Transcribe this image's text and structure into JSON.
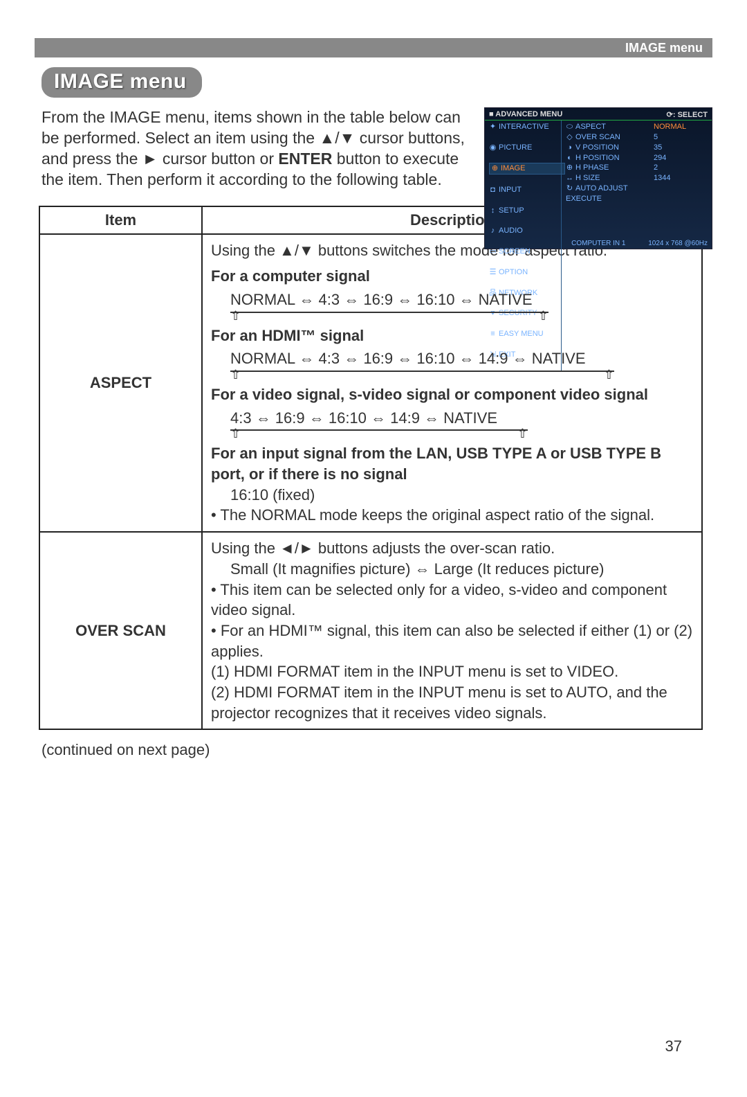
{
  "header": {
    "right": "IMAGE menu"
  },
  "pill": "IMAGE menu",
  "intro": "From the IMAGE menu, items shown in the table below can be performed.\nSelect an item using the ▲/▼ cursor buttons, and press the ► cursor button or ENTER button to execute the item. Then perform it according to the following table.",
  "osd": {
    "top_left": "■ ADVANCED MENU",
    "top_right": "⟳: SELECT",
    "left": [
      {
        "icon": "✦",
        "label": "INTERACTIVE"
      },
      {
        "icon": "◉",
        "label": "PICTURE"
      },
      {
        "icon": "⊕",
        "label": "IMAGE",
        "hl": true
      },
      {
        "icon": "◘",
        "label": "INPUT"
      },
      {
        "icon": "↕",
        "label": "SETUP"
      },
      {
        "icon": "♪",
        "label": "AUDIO"
      },
      {
        "icon": "▭",
        "label": "SCREEN"
      },
      {
        "icon": "☰",
        "label": "OPTION"
      },
      {
        "icon": "品",
        "label": "NETWORK"
      },
      {
        "icon": "♥",
        "label": "SECURITY"
      },
      {
        "icon": "≡",
        "label": "EASY MENU"
      },
      {
        "icon": "⇲",
        "label": "EXIT"
      }
    ],
    "mid": [
      {
        "icon": "⬭",
        "label": "ASPECT"
      },
      {
        "icon": "◇",
        "label": "OVER SCAN"
      },
      {
        "icon": "◑",
        "label": "V POSITION"
      },
      {
        "icon": "◐",
        "label": "H POSITION"
      },
      {
        "icon": "⊕",
        "label": "H PHASE"
      },
      {
        "icon": "↔",
        "label": "H SIZE"
      },
      {
        "icon": "↻",
        "label": "AUTO ADJUST EXECUTE"
      }
    ],
    "right": [
      {
        "label": "NORMAL",
        "hl": true
      },
      {
        "label": "5"
      },
      {
        "label": "35"
      },
      {
        "label": "294"
      },
      {
        "label": "2"
      },
      {
        "label": "1344"
      },
      {
        "label": ""
      }
    ],
    "foot_left": "COMPUTER IN 1",
    "foot_right": "1024 x 768 @60Hz"
  },
  "table": {
    "headers": {
      "item": "Item",
      "desc": "Description"
    },
    "rows": [
      {
        "item": "ASPECT",
        "desc": {
          "line1": "Using the ▲/▼ buttons switches the mode for aspect ratio.",
          "h1": "For a computer signal",
          "seq1": "NORMAL ⇔ 4:3 ⇔ 16:9 ⇔ 16:10 ⇔ NATIVE",
          "h2": "For an HDMI™ signal",
          "seq2": "NORMAL ⇔ 4:3 ⇔ 16:9 ⇔ 16:10 ⇔ 14:9 ⇔ NATIVE",
          "h3": "For a video signal, s-video signal or component video signal",
          "seq3": "4:3 ⇔ 16:9 ⇔ 16:10 ⇔ 14:9 ⇔ NATIVE",
          "h4": "For an input signal from the LAN, USB TYPE A or USB TYPE B port, or if there is no signal",
          "fixed": "16:10 (fixed)",
          "note": "• The NORMAL mode keeps the original aspect ratio of the signal."
        }
      },
      {
        "item": "OVER SCAN",
        "desc": {
          "line1": "Using the ◄/► buttons adjusts the over-scan ratio.",
          "line2": "Small (It magnifies picture) ⇔ Large (It reduces picture)",
          "b1": "• This item can be selected only for a video, s-video and component video signal.",
          "b2": "• For an HDMI™ signal, this item can also be selected if either (1) or (2) applies.",
          "s1": "(1) HDMI FORMAT item in the INPUT menu is set to VIDEO.",
          "s2": "(2) HDMI FORMAT item in the INPUT menu is set to AUTO, and the projector recognizes that it receives video signals."
        }
      }
    ]
  },
  "continued": "(continued on next page)",
  "page_number": "37"
}
